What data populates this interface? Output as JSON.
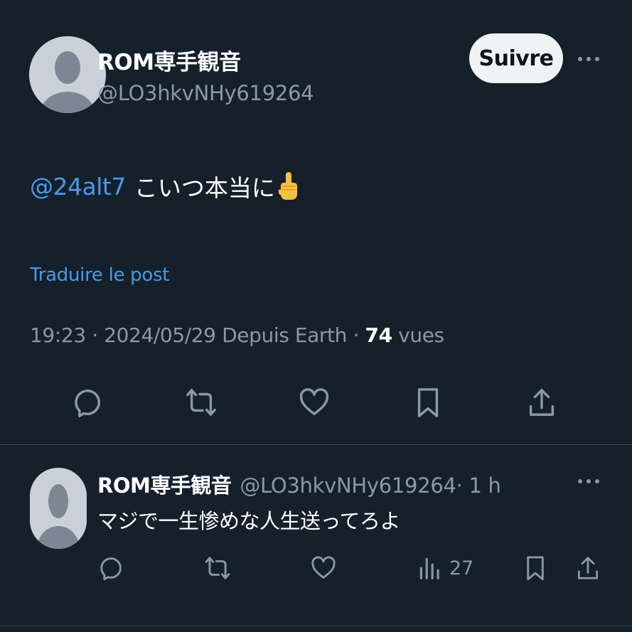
{
  "post": {
    "author": {
      "display_name": "ROM専手観音",
      "handle": "@LO3hkvNHy619264"
    },
    "follow_label": "Suivre",
    "mention": "@24alt7",
    "text": "こいつ本当に",
    "emoji": "middle-finger-emoji",
    "translate_label": "Traduire le post",
    "meta": {
      "time": "19:23",
      "sep1": " · ",
      "date": "2024/05/29",
      "source": " Depuis Earth",
      "sep2": " · ",
      "views": "74",
      "views_label": " vues"
    },
    "actions": [
      "reply-icon",
      "retweet-icon",
      "like-icon",
      "bookmark-icon",
      "share-icon"
    ]
  },
  "reply": {
    "author": {
      "display_name": "ROM専手観音",
      "handle": "@LO3hkvNHy619264",
      "time": " · 1 h"
    },
    "text": "マジで一生惨めな人生送ってろよ",
    "views": "27"
  },
  "colors": {
    "background": "#15202b",
    "link": "#4a99e9",
    "muted": "#8b98a5",
    "divider": "#38444d",
    "button_bg": "#eff3f4"
  }
}
